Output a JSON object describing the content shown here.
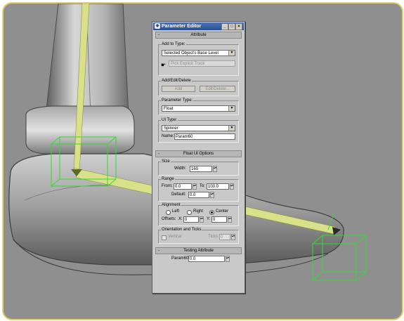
{
  "window": {
    "title": "Parameter Editor",
    "icon": "app-icon",
    "controls": [
      "_",
      "□",
      "×"
    ]
  },
  "attribute": {
    "rollout_label": "Attribute",
    "collapse_sign": "-",
    "add_to_type": {
      "label": "Add to Type:",
      "selected": "Selected Object's Base Level",
      "pick_label": "Pick Explicit Track"
    },
    "add_edit_delete": {
      "label": "Add/Edit/Delete",
      "add": "Add",
      "edit": "Edit/Delete..."
    },
    "parameter_type": {
      "label": "Parameter Type:",
      "selected": "Float"
    },
    "ui_type": {
      "label": "UI Type:",
      "selected": "Spinner"
    },
    "name": {
      "label": "Name:",
      "value": "Param60"
    }
  },
  "float_ui": {
    "rollout_label": "Float UI Options",
    "collapse_sign": "-",
    "size": {
      "label": "Size",
      "width_label": "Width:",
      "width": "160"
    },
    "range": {
      "label": "Range",
      "from_label": "From:",
      "from": "0.0",
      "to_label": "To:",
      "to": "100.0",
      "default_label": "Default:",
      "default": "0.0"
    },
    "alignment": {
      "label": "Alignment",
      "left": "Left",
      "right": "Right",
      "center": "Center",
      "selected": "Center",
      "offsets_label": "Offsets:",
      "x_label": "X:",
      "x": "0",
      "y_label": "Y:",
      "y": "0"
    },
    "orientation": {
      "label": "Orientation and Ticks",
      "vertical": "Vertical",
      "ticks_label": "Ticks:",
      "ticks": "0"
    }
  },
  "testing": {
    "rollout_label": "Testing Attribute",
    "collapse_sign": "-",
    "param_label": "Param60",
    "param_value": "0.0"
  },
  "colors": {
    "viewport_bg": "#8f8f8f",
    "bone_yellow": "#d9e08a",
    "helper_green": "#35d935",
    "frame_border": "#e2cf6e"
  }
}
